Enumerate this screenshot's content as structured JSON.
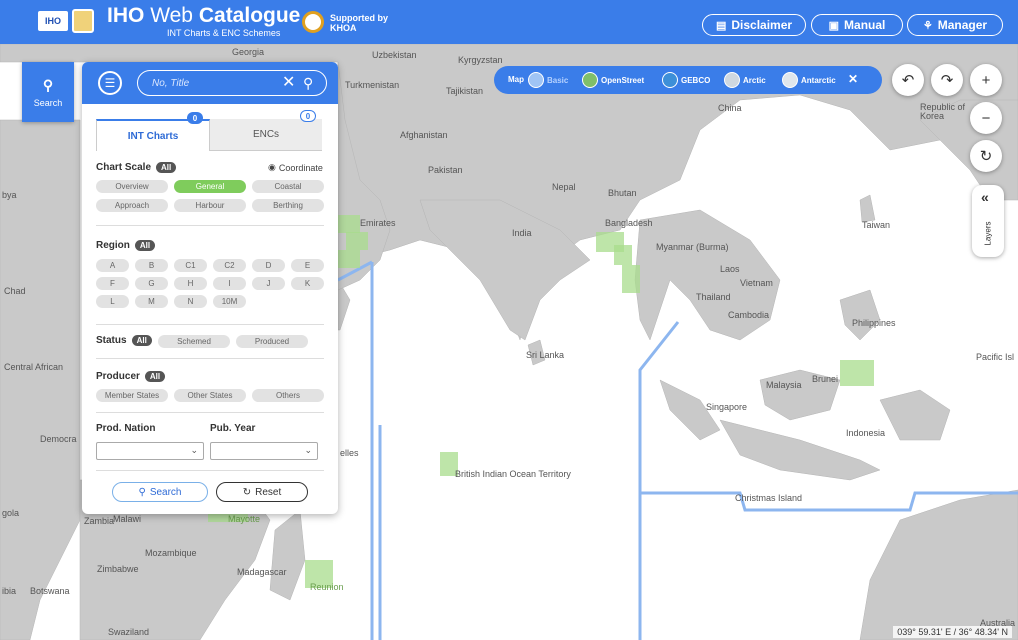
{
  "header": {
    "iho_badge": "IHO",
    "title_bold": "IHO",
    "title_light": "Web",
    "title_rest": "Catalogue",
    "subtitle": "INT Charts & ENC Schemes",
    "supported_line1": "Supported by",
    "supported_line2": "KHOA",
    "buttons": [
      {
        "label": "Disclaimer",
        "icon": "document-icon"
      },
      {
        "label": "Manual",
        "icon": "book-icon"
      },
      {
        "label": "Manager",
        "icon": "network-icon"
      }
    ]
  },
  "search_toggle": {
    "label": "Search",
    "icon": "search-icon"
  },
  "panel": {
    "search_placeholder": "No, Title",
    "tabs": [
      {
        "label": "INT Charts",
        "count": "0",
        "active": true
      },
      {
        "label": "ENCs",
        "count": "0",
        "active": false
      }
    ],
    "chart_scale": {
      "title": "Chart Scale",
      "all": "All",
      "coordinate": "Coordinate",
      "options": [
        "Overview",
        "General",
        "Coastal",
        "Approach",
        "Harbour",
        "Berthing"
      ],
      "selected": "General"
    },
    "region": {
      "title": "Region",
      "all": "All",
      "options": [
        "A",
        "B",
        "C1",
        "C2",
        "D",
        "E",
        "F",
        "G",
        "H",
        "I",
        "J",
        "K",
        "L",
        "M",
        "N",
        "10M"
      ]
    },
    "status": {
      "title": "Status",
      "all": "All",
      "options": [
        "Schemed",
        "Produced"
      ]
    },
    "producer": {
      "title": "Producer",
      "all": "All",
      "options": [
        "Member States",
        "Other States",
        "Others"
      ]
    },
    "prod_nation": {
      "label": "Prod. Nation",
      "value": ""
    },
    "pub_year": {
      "label": "Pub. Year",
      "value": ""
    },
    "search_button": "Search",
    "reset_button": "Reset"
  },
  "basemap": {
    "prefix": "Map",
    "options": [
      "Basic",
      "OpenStreet",
      "GEBCO",
      "Arctic",
      "Antarctic"
    ],
    "selected": "Basic"
  },
  "controls": {
    "layers_label": "Layers"
  },
  "map": {
    "coordinates": "039° 59.31' E  /  36° 48.34' N",
    "labels": [
      "Georgia",
      "Uzbekistan",
      "Kyrgyzstan",
      "Turkmenistan",
      "Tajikistan",
      "China",
      "Republic of Korea",
      "Afghanistan",
      "Pakistan",
      "Nepal",
      "Bhutan",
      "India",
      "Bangladesh",
      "Taiwan",
      "Myanmar (Burma)",
      "Laos",
      "Vietnam",
      "Thailand",
      "Cambodia",
      "Philippines",
      "Sri Lanka",
      "Pacific Isl",
      "Malaysia",
      "Brunei",
      "Singapore",
      "Indonesia",
      "British Indian Ocean Territory",
      "Christmas Island",
      "Zambia",
      "Malawi",
      "Mozambique",
      "Zimbabwe",
      "Madagascar",
      "Reunion",
      "Botswana",
      "Swaziland",
      "Australia",
      "Chad",
      "Central African",
      "Democra",
      "gola",
      "ibia",
      "bya",
      "Emirates",
      "elles",
      "Mayotte"
    ]
  },
  "colors": {
    "primary": "#3a7de9",
    "land": "#c9c9c9",
    "sea": "#ffffff",
    "chart_coverage": "#a8dc8c",
    "selected_pill": "#7fcc5c"
  }
}
